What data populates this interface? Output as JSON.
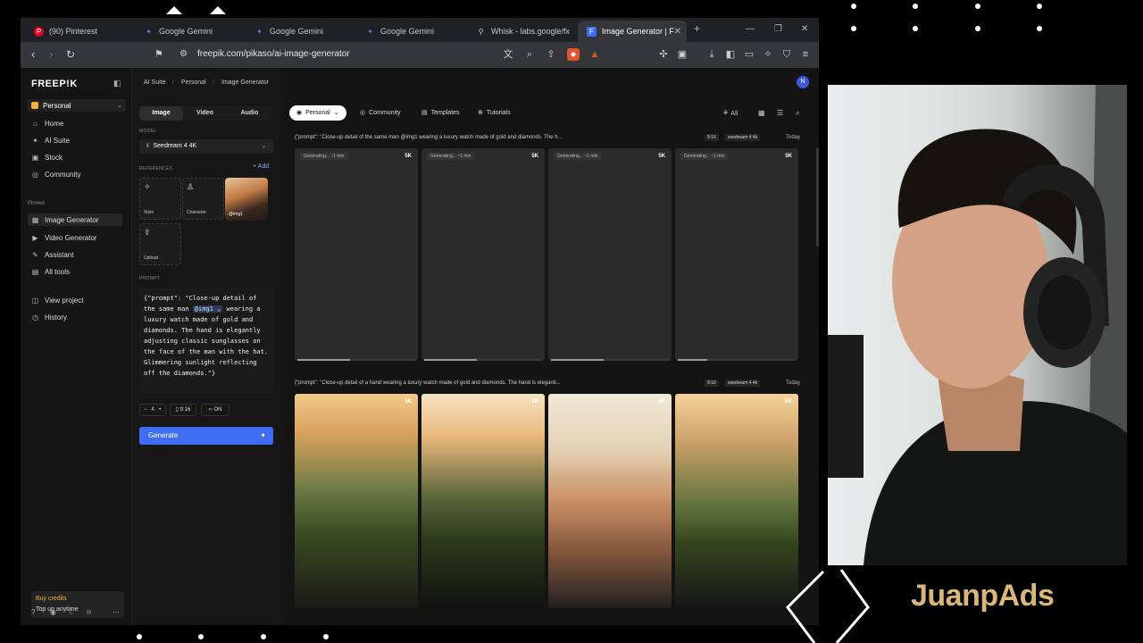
{
  "browser": {
    "tabs": [
      {
        "title": "(90) Pinterest",
        "favicon": "pinterest-icon",
        "color": "#e60023"
      },
      {
        "title": "Google Gemini",
        "favicon": "gemini-icon",
        "color": "#4a8af4"
      },
      {
        "title": "Google Gemini",
        "favicon": "gemini-icon",
        "color": "#4a8af4"
      },
      {
        "title": "Google Gemini",
        "favicon": "gemini-icon",
        "color": "#4a8af4"
      },
      {
        "title": "Whisk - labs.google/fx",
        "favicon": "whisk-icon",
        "color": "#888888"
      },
      {
        "title": "Image Generator | F",
        "favicon": "freepik-icon",
        "color": "#3f6ef5",
        "active": true
      }
    ],
    "url": "freepik.com/pikaso/ai-image-generator"
  },
  "sidebar": {
    "logo": "FREEP!K",
    "workspace": "Personal",
    "nav": [
      {
        "label": "Home",
        "icon": "home-icon",
        "glyph": "⌂"
      },
      {
        "label": "AI Suite",
        "icon": "ai-suite-icon",
        "glyph": "✦"
      },
      {
        "label": "Stock",
        "icon": "stock-icon",
        "glyph": "▣"
      },
      {
        "label": "Community",
        "icon": "community-icon",
        "glyph": "◎"
      }
    ],
    "pinned_label": "Pinned",
    "pinned": [
      {
        "label": "Image Generator",
        "icon": "image-generator-icon",
        "glyph": "▦",
        "selected": true
      },
      {
        "label": "Video Generator",
        "icon": "video-generator-icon",
        "glyph": "▶"
      },
      {
        "label": "Assistant",
        "icon": "assistant-icon",
        "glyph": "✎"
      },
      {
        "label": "All tools",
        "icon": "all-tools-icon",
        "glyph": "▤"
      }
    ],
    "extra": [
      {
        "label": "View project",
        "icon": "view-project-icon",
        "glyph": "◫"
      },
      {
        "label": "History",
        "icon": "history-icon",
        "glyph": "◷"
      }
    ],
    "credits": {
      "title": "Buy credits",
      "subtitle": "Top up anytime"
    }
  },
  "breadcrumb": [
    "AI Suite",
    "Personal",
    "Image Generator"
  ],
  "panel": {
    "mode_tabs": [
      "Image",
      "Video",
      "Audio"
    ],
    "model_label": "MODEL",
    "model": "Seedream 4 4K",
    "references_label": "REFERENCES",
    "add_label": "+ Add",
    "refs": [
      {
        "label": "Style",
        "icon": "style-icon",
        "glyph": "✧"
      },
      {
        "label": "Character",
        "icon": "character-icon",
        "glyph": "♙"
      },
      {
        "label": "@img1",
        "icon": "reference-image"
      }
    ],
    "upload_label": "Upload",
    "prompt_label": "PROMPT",
    "prompt_before": "{\"prompt\": \"Close-up detail of the same man ",
    "prompt_tag": "@img1 ⌄",
    "prompt_after": " wearing a luxury watch made of gold and diamonds. The hand is elegantly adjusting classic sunglasses on the face of the man with the hat. Glimmering sunlight reflecting off the diamonds.\"}",
    "count": "4",
    "aspect": "9:16",
    "toggle": "ON",
    "generate": "Generate"
  },
  "main": {
    "avatar": "N",
    "filters": [
      "Personal",
      "Community",
      "Templates",
      "Tutorials"
    ],
    "all_label": "All",
    "rows": [
      {
        "prompt": "{\"prompt\": \"Close-up detail of the same man @img1 wearing a luxury watch made of gold and diamonds. The h...",
        "aspect": "9:16",
        "model": "seedream 4 4k",
        "date": "Today",
        "cards": [
          {
            "status": "Generating... ~1 min",
            "res": "5K",
            "progress": 0.45
          },
          {
            "status": "Generating... ~1 min",
            "res": "5K",
            "progress": 0.45
          },
          {
            "status": "Generating... ~1 min",
            "res": "5K",
            "progress": 0.45
          },
          {
            "status": "Generating... ~1 min",
            "res": "5K",
            "progress": 0.25
          }
        ]
      },
      {
        "prompt": "{\"prompt\": \"Close-up detail of a hand wearing a luxury watch made of gold and diamonds. The hand is eleganti...",
        "aspect": "9:16",
        "model": "seedream 4 4k",
        "date": "Today",
        "images": [
          {
            "res": "5K"
          },
          {
            "res": "5K"
          },
          {
            "res": "5K"
          },
          {
            "res": "5K"
          }
        ]
      }
    ]
  },
  "overlay": {
    "brand": "JuanpAds"
  }
}
